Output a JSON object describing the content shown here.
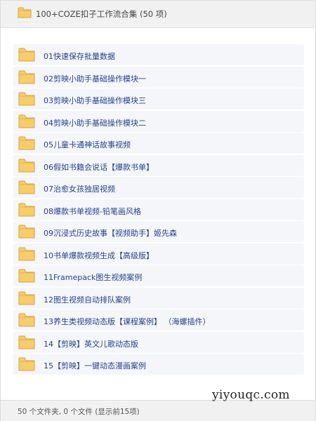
{
  "header": {
    "title": "100+COZE扣子工作流合集 (50 项)",
    "icon": "folder-icon"
  },
  "items": [
    {
      "label": "01快速保存批量数据",
      "icon": "folder-icon"
    },
    {
      "label": "02剪映小助手基础操作模块一",
      "icon": "folder-icon"
    },
    {
      "label": "03剪映小助手基础操作模块三",
      "icon": "folder-icon"
    },
    {
      "label": "04剪映小助手基础操作模块二",
      "icon": "folder-icon"
    },
    {
      "label": "05儿童卡通神话故事视频",
      "icon": "folder-icon"
    },
    {
      "label": "06假如书籍会说话【爆款书单】",
      "icon": "folder-icon"
    },
    {
      "label": "07治愈女孩独居视频",
      "icon": "folder-icon"
    },
    {
      "label": "08爆款书单视频-铅笔画风格",
      "icon": "folder-icon"
    },
    {
      "label": "09沉浸式历史故事【视频助手】姬先森",
      "icon": "folder-icon"
    },
    {
      "label": "10书单爆款视频生成【高级版】",
      "icon": "folder-icon"
    },
    {
      "label": "11Framepack图生视频案例",
      "icon": "folder-icon"
    },
    {
      "label": "12图生视频自动排队案例",
      "icon": "folder-icon"
    },
    {
      "label": "13养生类视频动态版【课程案例】 （海螺插件）",
      "icon": "folder-icon"
    },
    {
      "label": "14【剪映】英文儿歌动态版",
      "icon": "folder-icon"
    },
    {
      "label": "15【剪映】一键动态漫画案例",
      "icon": "folder-icon"
    }
  ],
  "footer": {
    "status": "50 个文件夹, 0 个文件 (显示前15项)"
  },
  "watermark": "yiyouqc.com",
  "colors": {
    "folder_fill": "#f7cc6b",
    "folder_stroke": "#d7a43e",
    "link_text": "#24418f",
    "row_bg": "#f5f6f9",
    "bar_bg": "#f1f1f1"
  }
}
